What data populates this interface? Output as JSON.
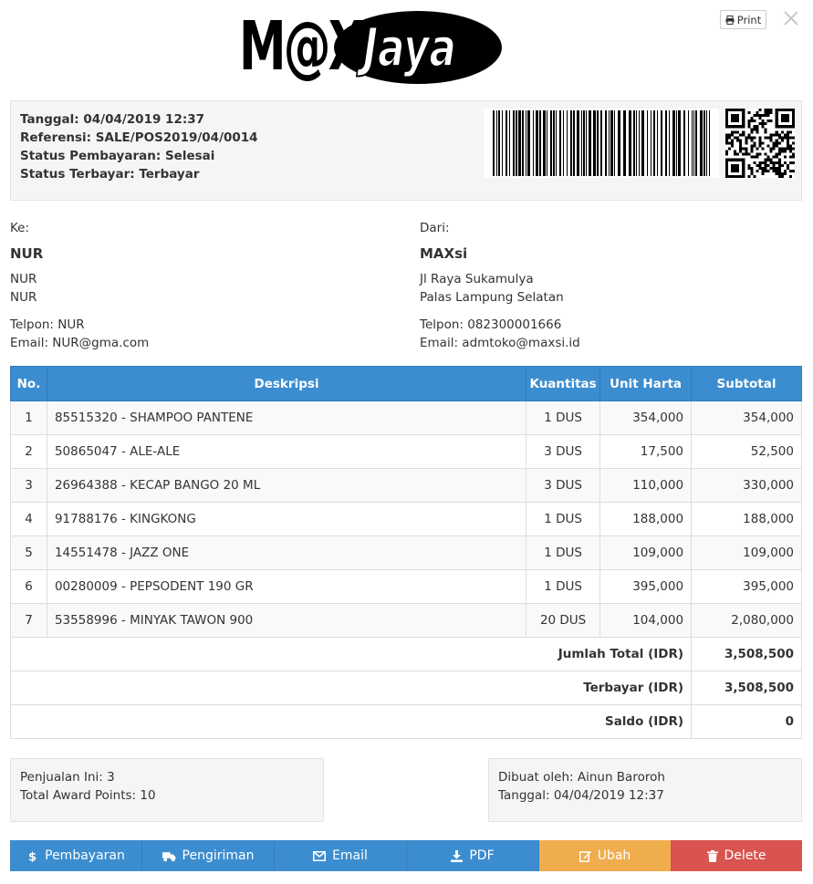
{
  "logo": {
    "left": "M@Xsi",
    "right": "Jaya"
  },
  "print_label": "Print",
  "info": {
    "tanggal": "Tanggal: 04/04/2019 12:37",
    "referensi": "Referensi: SALE/POS2019/04/0014",
    "status_pembayaran": "Status Pembayaran: Selesai",
    "status_terbayar": "Status Terbayar: Terbayar"
  },
  "to": {
    "label": "Ke:",
    "name": "NUR",
    "line1": "NUR",
    "line2": "NUR",
    "phone": "Telpon: NUR",
    "email": "Email: NUR@gma.com"
  },
  "from": {
    "label": "Dari:",
    "name": "MAXsi",
    "line1": "Jl Raya Sukamulya",
    "line2": "Palas Lampung Selatan",
    "phone": "Telpon: 082300001666",
    "email": "Email: admtoko@maxsi.id"
  },
  "table": {
    "headers": [
      "No.",
      "Deskripsi",
      "Kuantitas",
      "Unit Harta",
      "Subtotal"
    ],
    "rows": [
      [
        "1",
        "85515320 - SHAMPOO PANTENE",
        "1 DUS",
        "354,000",
        "354,000"
      ],
      [
        "2",
        "50865047 - ALE-ALE",
        "3 DUS",
        "17,500",
        "52,500"
      ],
      [
        "3",
        "26964388 - KECAP BANGO 20 ML",
        "3 DUS",
        "110,000",
        "330,000"
      ],
      [
        "4",
        "91788176 - KINGKONG",
        "1 DUS",
        "188,000",
        "188,000"
      ],
      [
        "5",
        "14551478 - JAZZ ONE",
        "1 DUS",
        "109,000",
        "109,000"
      ],
      [
        "6",
        "00280009 - PEPSODENT 190 GR",
        "1 DUS",
        "395,000",
        "395,000"
      ],
      [
        "7",
        "53558996 - MINYAK TAWON 900",
        "20 DUS",
        "104,000",
        "2,080,000"
      ]
    ],
    "totals": [
      {
        "label": "Jumlah Total (IDR)",
        "value": "3,508,500"
      },
      {
        "label": "Terbayar (IDR)",
        "value": "3,508,500"
      },
      {
        "label": "Saldo (IDR)",
        "value": "0"
      }
    ]
  },
  "summary_left": {
    "penjualan": "Penjualan Ini: 3",
    "award": "Total Award Points: 10"
  },
  "summary_right": {
    "dibuat": "Dibuat oleh: Ainun Baroroh",
    "tanggal": "Tanggal: 04/04/2019 12:37"
  },
  "actions": {
    "pembayaran": "Pembayaran",
    "pengiriman": "Pengiriman",
    "email": "Email",
    "pdf": "PDF",
    "ubah": "Ubah",
    "delete": "Delete"
  },
  "colors": {
    "primary": "#3c8dcf",
    "warning": "#f0ad4e",
    "danger": "#d9534f",
    "well": "#f5f5f5"
  },
  "icons": [
    "print-icon",
    "close-icon",
    "barcode-image",
    "qr-code-image",
    "dollar-icon",
    "truck-icon",
    "envelope-icon",
    "download-icon",
    "edit-icon",
    "trash-icon"
  ]
}
